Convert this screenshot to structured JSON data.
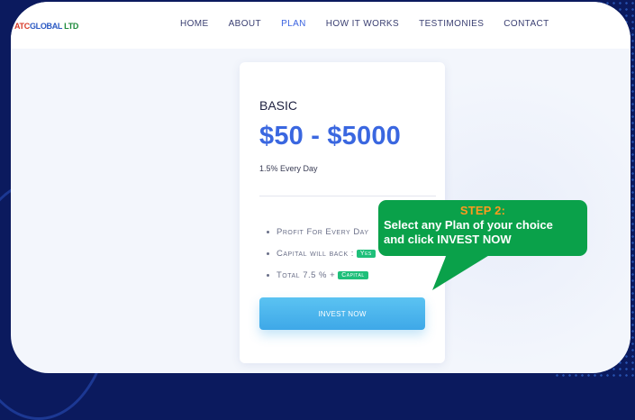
{
  "logo": {
    "text_a": "ATC",
    "text_b": "GLOBAL",
    "text_c": " LTD"
  },
  "nav": [
    {
      "label": "HOME",
      "active": false
    },
    {
      "label": "ABOUT",
      "active": false
    },
    {
      "label": "PLAN",
      "active": true
    },
    {
      "label": "HOW IT WORKS",
      "active": false
    },
    {
      "label": "TESTIMONIES",
      "active": false
    },
    {
      "label": "CONTACT",
      "active": false
    }
  ],
  "plan": {
    "name": "BASIC",
    "price": "$50 - $5000",
    "rate": "1.5% Every Day",
    "features": [
      {
        "text": "Profit For Every Day",
        "badge": ""
      },
      {
        "text": "Capital will back :",
        "badge": "Yes"
      },
      {
        "text": "Total 7.5 % +",
        "badge": "Capital"
      }
    ],
    "button_label": "INVEST NOW"
  },
  "callout": {
    "title": "STEP 2:",
    "line1": "Select any Plan of your choice",
    "line2": "and click INVEST NOW"
  },
  "colors": {
    "accent": "#3a67e0",
    "callout_bg": "#0aa14a",
    "callout_title": "#ff9a1e",
    "button": "#4bb5ee",
    "badge": "#1fbf7a",
    "outer_bg": "#0b1a5e"
  }
}
